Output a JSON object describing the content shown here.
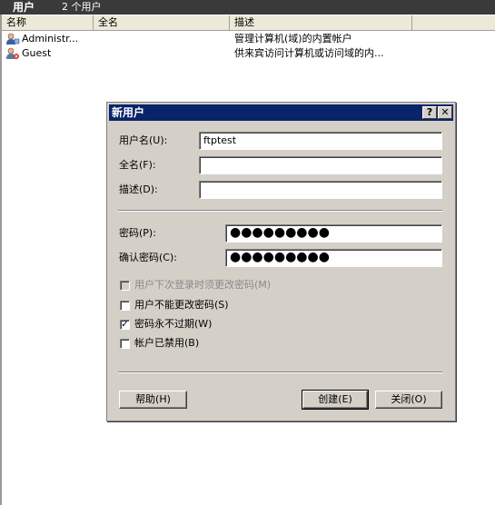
{
  "header": {
    "title": "用户",
    "count": "2 个用户"
  },
  "list": {
    "columns": [
      "名称",
      "全名",
      "描述"
    ],
    "rows": [
      {
        "name": "Administr...",
        "full_name": "",
        "description": "管理计算机(域)的内置帐户",
        "icon": "user-icon"
      },
      {
        "name": "Guest",
        "full_name": "",
        "description": "供来宾访问计算机或访问域的内...",
        "icon": "guest-user-icon"
      }
    ]
  },
  "dialog": {
    "title": "新用户",
    "help_glyph": "?",
    "close_glyph": "✕",
    "username_label": "用户名(U):",
    "username_value": "ftptest",
    "fullname_label": "全名(F):",
    "fullname_value": "",
    "description_label": "描述(D):",
    "description_value": "",
    "password_label": "密码(P):",
    "password_value": "●●●●●●●●●",
    "confirm_label": "确认密码(C):",
    "confirm_value": "●●●●●●●●●",
    "options": [
      {
        "label": "用户下次登录时须更改密码(M)",
        "checked": false,
        "disabled": true
      },
      {
        "label": "用户不能更改密码(S)",
        "checked": false,
        "disabled": false
      },
      {
        "label": "密码永不过期(W)",
        "checked": true,
        "disabled": false
      },
      {
        "label": "帐户已禁用(B)",
        "checked": false,
        "disabled": false
      }
    ],
    "help_button": "帮助(H)",
    "create_button": "创建(E)",
    "close_button": "关闭(O)"
  }
}
